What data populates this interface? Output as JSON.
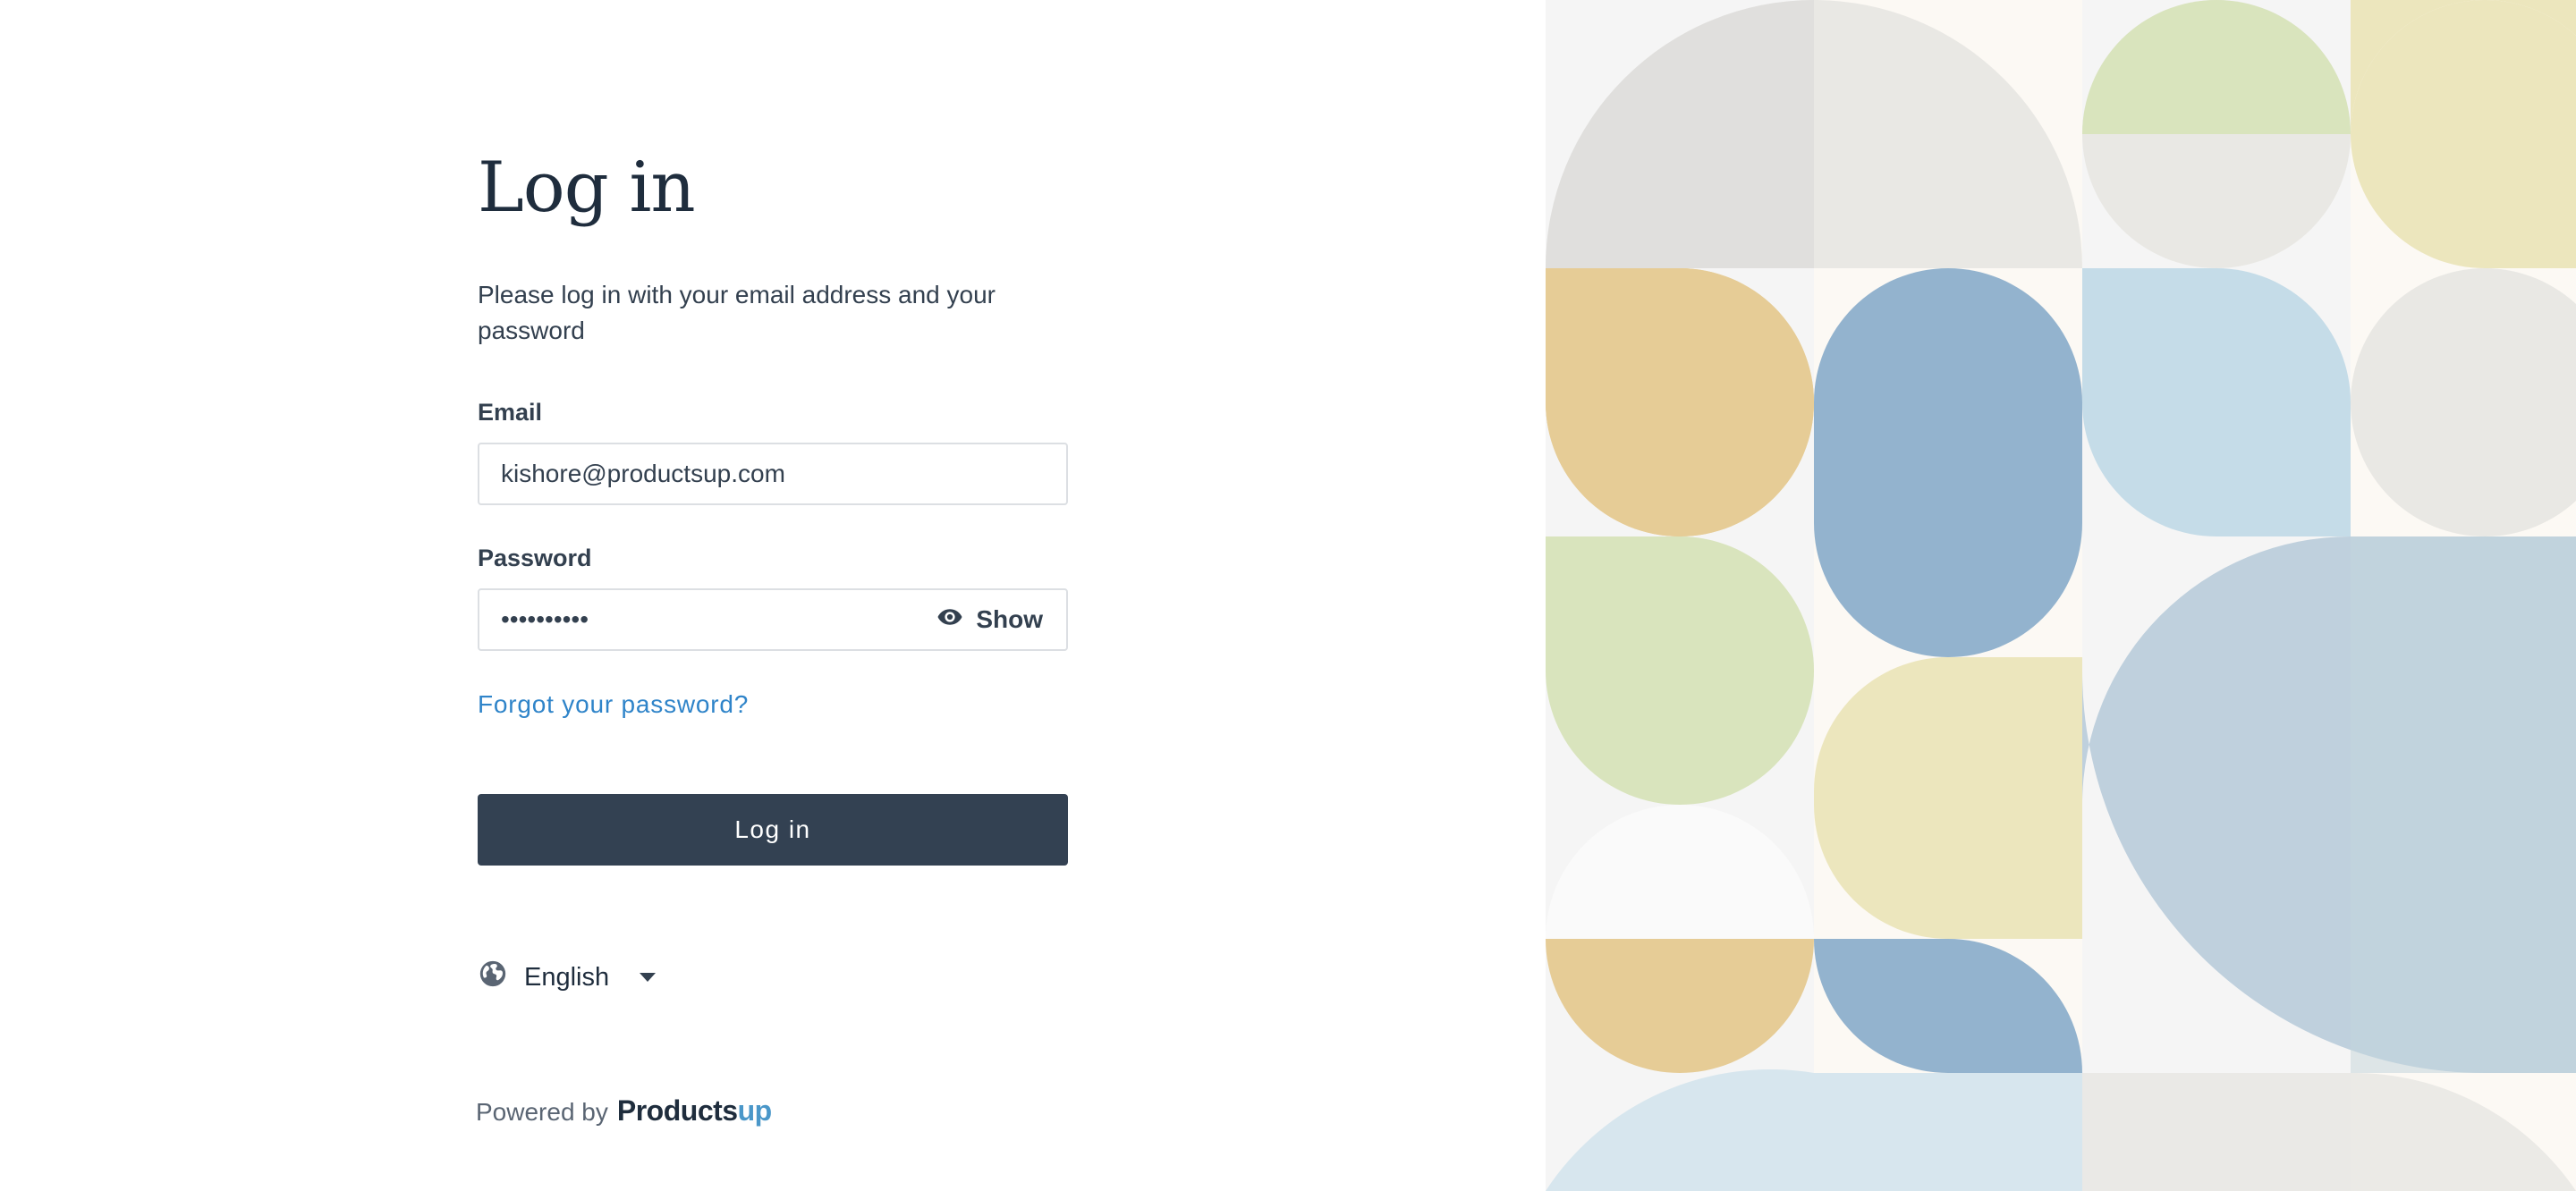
{
  "login": {
    "title": "Log in",
    "subtitle": "Please log in with your email address and your password",
    "email_label": "Email",
    "email_value": "kishore@productsup.com",
    "password_label": "Password",
    "password_masked": "••••••••••",
    "show_label": "Show",
    "forgot_link": "Forgot your password?",
    "submit_label": "Log in"
  },
  "language": {
    "selected": "English"
  },
  "footer": {
    "powered_by": "Powered by",
    "brand_main": "Products",
    "brand_accent": "up"
  },
  "colors": {
    "button_bg": "#334152",
    "link": "#2f84c9",
    "brand_accent": "#4a97c9",
    "pattern": [
      "#e0dfdd",
      "#e9e8e4",
      "#d9e4bd",
      "#ece6bd",
      "#e6cc96",
      "#93b3ce",
      "#c5dce8",
      "#bfd0dd",
      "#d7e6ee",
      "#f5f5f5",
      "#fcf9f4",
      "#fafafa"
    ]
  },
  "icons": {
    "password_toggle": "eye-icon",
    "language": "globe-icon",
    "dropdown": "caret-down-icon"
  }
}
